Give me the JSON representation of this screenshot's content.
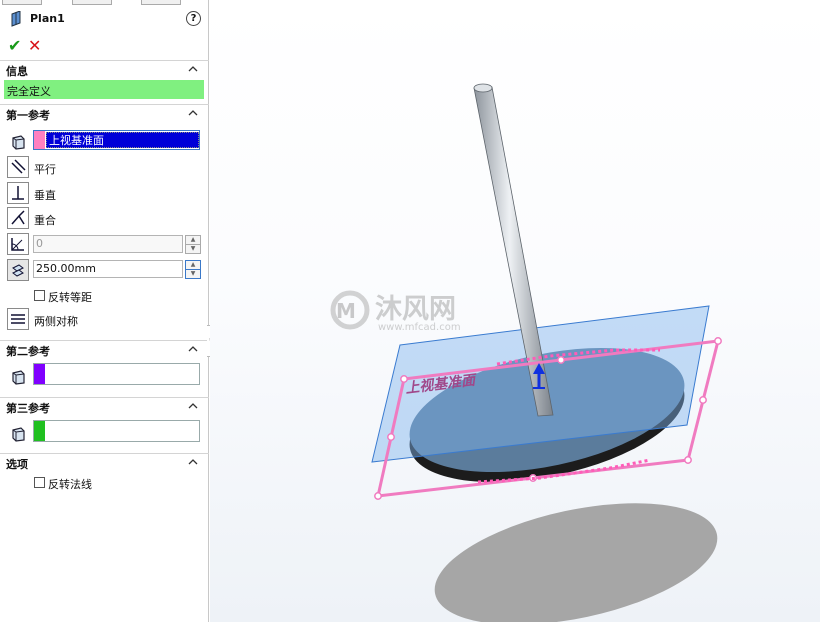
{
  "panel": {
    "title": "Plan1",
    "help_glyph": "?",
    "ok_glyph": "✔",
    "cancel_glyph": "✕",
    "sections": {
      "info": "信息",
      "first_ref": "第一参考",
      "second_ref": "第二参考",
      "third_ref": "第三参考",
      "options": "选项"
    },
    "info_message": "完全定义",
    "first_ref_value": "上视基准面",
    "constraints": {
      "parallel": "平行",
      "perpendicular": "垂直",
      "coincident": "重合"
    },
    "angle_value": "0",
    "distance_value": "250.00mm",
    "flip_offset_label": "反转等距",
    "mid_plane_label": "两侧对称",
    "flip_normal_label": "反转法线",
    "colors": {
      "first_ref_swatch": "#ff80c0",
      "second_ref_swatch": "#8000ff",
      "third_ref_swatch": "#20c020",
      "message_bg": "#80f080",
      "selection_bg": "#0000d8"
    }
  },
  "viewport": {
    "plane_label": "上视基准面",
    "watermark_brand": "沐风网",
    "watermark_url": "www.mfcad.com"
  }
}
